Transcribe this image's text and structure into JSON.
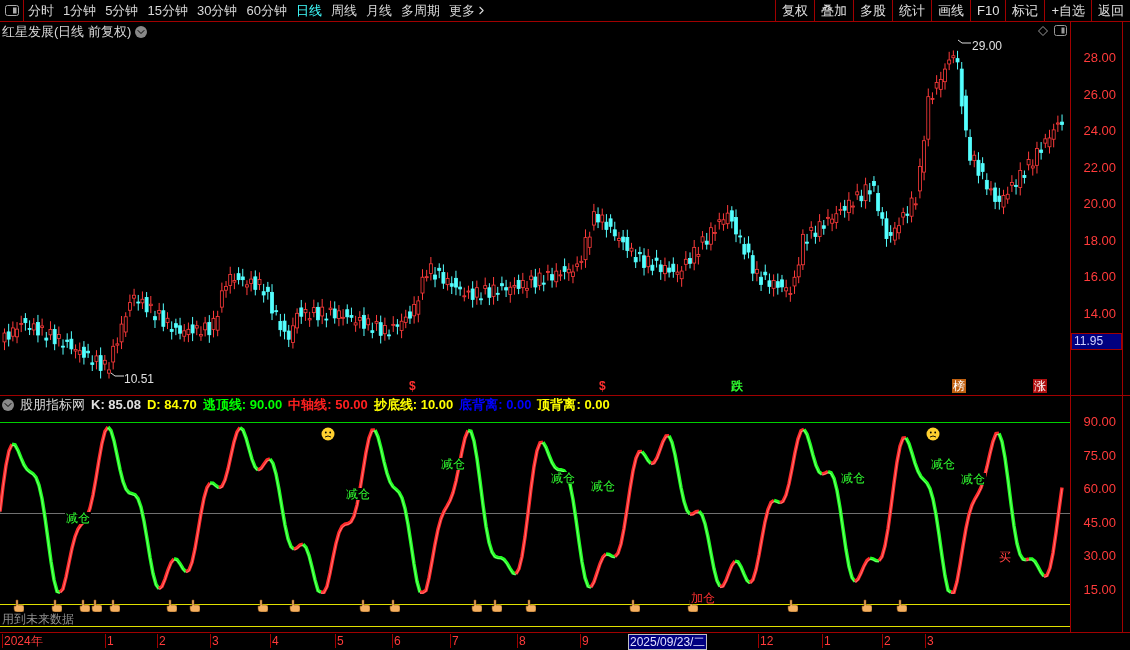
{
  "toolbar": {
    "periods": [
      {
        "label": "分时",
        "selected": false
      },
      {
        "label": "1分钟",
        "selected": false
      },
      {
        "label": "5分钟",
        "selected": false
      },
      {
        "label": "15分钟",
        "selected": false
      },
      {
        "label": "30分钟",
        "selected": false
      },
      {
        "label": "60分钟",
        "selected": false
      },
      {
        "label": "日线",
        "selected": true
      },
      {
        "label": "周线",
        "selected": false
      },
      {
        "label": "月线",
        "selected": false
      },
      {
        "label": "多周期",
        "selected": false
      },
      {
        "label": "更多",
        "selected": false
      }
    ],
    "actions": [
      "复权",
      "叠加",
      "多股",
      "统计",
      "画线",
      "F10",
      "标记",
      "+自选",
      "返回"
    ]
  },
  "price_chart": {
    "title": "红星发展(日线 前复权)",
    "y_ticks": [
      "28.00",
      "26.00",
      "24.00",
      "22.00",
      "20.00",
      "18.00",
      "16.00",
      "14.00"
    ],
    "high_label": "29.00",
    "low_label": "10.51",
    "current_price": "11.95",
    "event_markers": [
      {
        "label": "$",
        "kind": "text",
        "color": "#ff3030"
      },
      {
        "label": "$",
        "kind": "text",
        "color": "#ff3030"
      },
      {
        "label": "跌",
        "kind": "text",
        "color": "#30ff30"
      },
      {
        "label": "榜",
        "kind": "tag",
        "color": "#c06010"
      },
      {
        "label": "涨",
        "kind": "tag",
        "color": "#b01010"
      }
    ]
  },
  "indicator": {
    "name": "股朋指标网",
    "readouts": [
      {
        "label": "K: 85.08",
        "color": "#e0e0e0"
      },
      {
        "label": "D: 84.70",
        "color": "#ffff00"
      },
      {
        "label": "逃顶线: 90.00",
        "color": "#00ff00"
      },
      {
        "label": "中轴线: 50.00",
        "color": "#ff2020"
      },
      {
        "label": "抄底线: 10.00",
        "color": "#ffff00"
      },
      {
        "label": "底背离: 0.00",
        "color": "#0000ff"
      },
      {
        "label": "顶背离: 0.00",
        "color": "#ffff00"
      }
    ],
    "y_ticks": [
      "90.00",
      "75.00",
      "60.00",
      "45.00",
      "30.00",
      "15.00"
    ],
    "signals": [
      {
        "label": "减仓",
        "kind": "sell"
      },
      {
        "label": "减仓",
        "kind": "sell"
      },
      {
        "label": "减仓",
        "kind": "sell"
      },
      {
        "label": "减仓",
        "kind": "sell"
      },
      {
        "label": "减仓",
        "kind": "sell"
      },
      {
        "label": "加仓",
        "kind": "add"
      },
      {
        "label": "减仓",
        "kind": "sell"
      },
      {
        "label": "减仓",
        "kind": "sell"
      },
      {
        "label": "减仓",
        "kind": "sell"
      },
      {
        "label": "买",
        "kind": "buy"
      }
    ],
    "future_data_note": "用到未来数据"
  },
  "date_axis": [
    {
      "label": "2024年",
      "selected": false
    },
    {
      "label": "1",
      "selected": false
    },
    {
      "label": "2",
      "selected": false
    },
    {
      "label": "3",
      "selected": false
    },
    {
      "label": "4",
      "selected": false
    },
    {
      "label": "5",
      "selected": false
    },
    {
      "label": "6",
      "selected": false
    },
    {
      "label": "7",
      "selected": false
    },
    {
      "label": "8",
      "selected": false
    },
    {
      "label": "9",
      "selected": false
    },
    {
      "label": "2025/09/23/二",
      "selected": true
    },
    {
      "label": "12",
      "selected": false
    },
    {
      "label": "1",
      "selected": false
    },
    {
      "label": "2",
      "selected": false
    },
    {
      "label": "3",
      "selected": false
    }
  ]
}
